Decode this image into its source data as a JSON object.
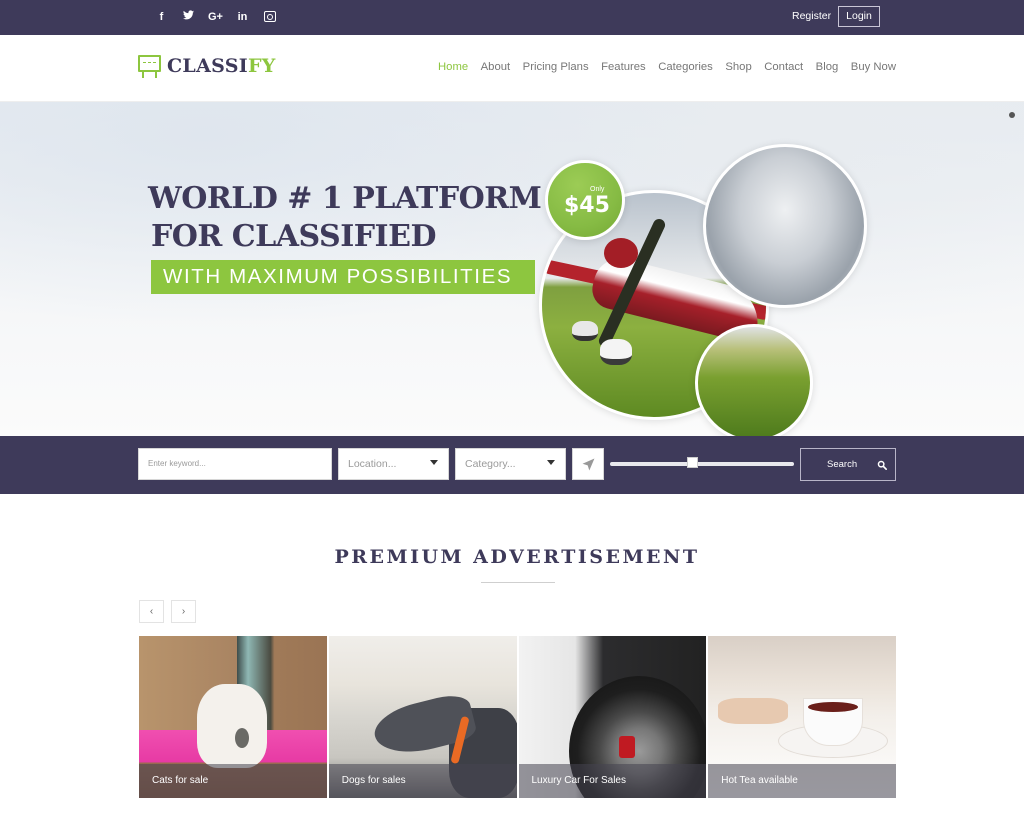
{
  "topbar": {
    "social_icons": [
      {
        "name": "facebook-icon",
        "glyph": "f"
      },
      {
        "name": "twitter-icon",
        "glyph": "🐦"
      },
      {
        "name": "google-plus-icon",
        "glyph": "G+"
      },
      {
        "name": "linkedin-icon",
        "glyph": "in"
      },
      {
        "name": "instagram-icon",
        "glyph": ""
      }
    ],
    "register_label": "Register",
    "login_label": "Login"
  },
  "header": {
    "logo_main": "CLASSI",
    "logo_accent": "FY",
    "nav": [
      {
        "label": "Home",
        "active": true
      },
      {
        "label": "About"
      },
      {
        "label": "Pricing Plans"
      },
      {
        "label": "Features"
      },
      {
        "label": "Categories"
      },
      {
        "label": "Shop"
      },
      {
        "label": "Contact"
      },
      {
        "label": "Blog"
      },
      {
        "label": "Buy Now"
      }
    ]
  },
  "hero": {
    "title_line1": "WORLD # 1 PLATFORM",
    "title_line2": "FOR CLASSIFIED",
    "subtitle": "WITH MAXIMUM POSSIBILITIES",
    "price_prefix": "Only",
    "price": "$45"
  },
  "search": {
    "keyword_placeholder": "Enter keyword...",
    "location_placeholder": "Location...",
    "category_placeholder": "Category...",
    "distance_slider_value": 0.45,
    "search_label": "Search"
  },
  "premium": {
    "title": "PREMIUM ADVERTISEMENT",
    "prev_label": "‹",
    "next_label": "›",
    "cards": [
      {
        "caption": "Cats for sale"
      },
      {
        "caption": "Dogs for sales"
      },
      {
        "caption": "Luxury Car For Sales"
      },
      {
        "caption": "Hot Tea available"
      }
    ]
  },
  "colors": {
    "brand_dark": "#3e3a5a",
    "brand_green": "#8dc63f"
  }
}
